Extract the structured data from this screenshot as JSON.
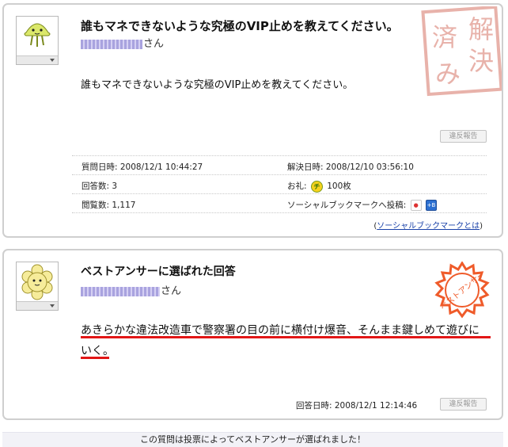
{
  "question": {
    "title": "誰もマネできないような究極のVIP止めを教えてください。",
    "user_suffix": "さん",
    "body": "誰もマネできないような究極のVIP止めを教えてください。",
    "report_label": "違反報告",
    "stamp_text": [
      "解",
      "済",
      "決",
      "み"
    ],
    "info": {
      "asked_label": "質問日時: 2008/12/1 10:44:27",
      "resolved_label": "解決日時: 2008/12/10 03:56:10",
      "answers_label": "回答数: 3",
      "reward_prefix": "お礼:",
      "reward_icon": "チ",
      "reward_value": "100枚",
      "views_label": "閲覧数: 1,117",
      "social_label": "ソーシャルブックマークへ投稿:",
      "social_icon_text": "+B",
      "social_link_open": "(",
      "social_link_text": "ソーシャルブックマークとは",
      "social_link_close": ")"
    }
  },
  "best_answer": {
    "title": "ベストアンサーに選ばれた回答",
    "user_suffix": "さん",
    "text": "あきらかな違法改造車で警察署の目の前に横付け爆音、そんまま鍵しめて遊びにいく。",
    "stamp_text": "ベストアンサー",
    "answered_label": "回答日時: 2008/12/1 12:14:46",
    "report_label": "違反報告"
  },
  "footer": {
    "note": "この質問は投票によってベストアンサーが選ばれました！"
  },
  "colors": {
    "stamp_solved": "#e8b2aa",
    "stamp_best": "#ef5b2a",
    "underline": "#e21616",
    "link": "#1840a8"
  }
}
